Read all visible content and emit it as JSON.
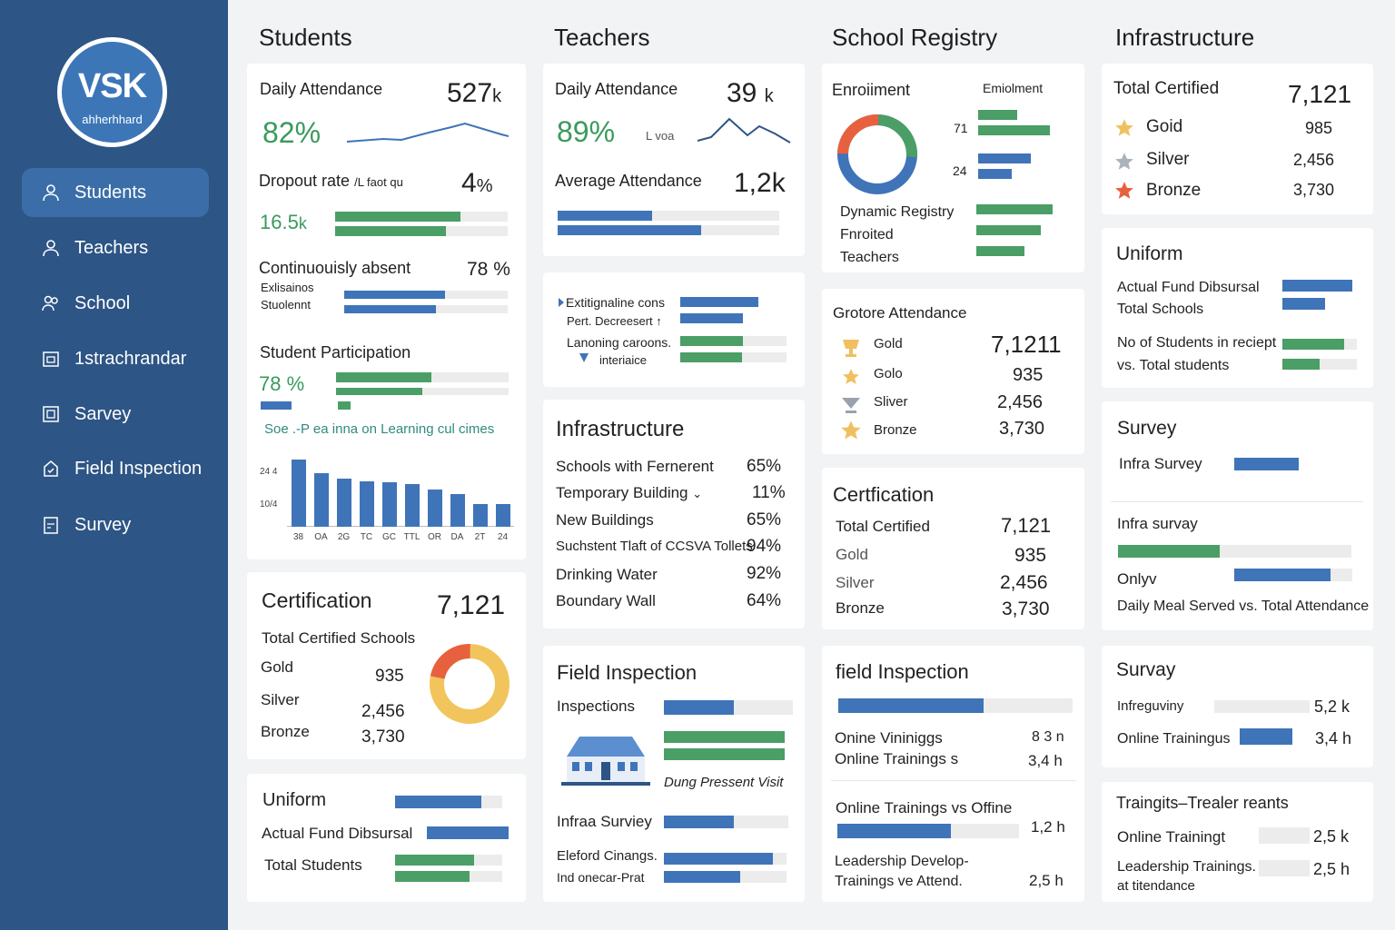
{
  "sidebar": {
    "logo_main": "VSK",
    "logo_sub": "ahherhhard",
    "items": [
      {
        "label": "Students",
        "icon": "user-icon"
      },
      {
        "label": "Teachers",
        "icon": "user-icon"
      },
      {
        "label": "School",
        "icon": "users-icon"
      },
      {
        "label": "1strachrandar",
        "icon": "calendar-icon"
      },
      {
        "label": "Sarvey",
        "icon": "clipboard-icon"
      },
      {
        "label": "Field Inspection",
        "icon": "inspection-icon"
      },
      {
        "label": "Survey",
        "icon": "document-icon"
      }
    ]
  },
  "headers": {
    "students": "Students",
    "teachers": "Teachers",
    "registry": "School Registry",
    "infrastructure": "Infrastructure"
  },
  "students": {
    "daily": {
      "title": "Daily Attendance",
      "value": "527",
      "unit": "k",
      "pct": "82%"
    },
    "dropout": {
      "title": "Dropout rate",
      "sub": "/L faot qu",
      "pct": "4",
      "unit": "%",
      "count": "16.5",
      "count_unit": "k"
    },
    "absent": {
      "title": "Continuouisly absent",
      "pct": "78",
      "unit": "%",
      "line1": "Exlisainos",
      "line2": "Stuolennt"
    },
    "participation": {
      "title": "Student Participation",
      "pct": "78",
      "unit": "%",
      "link": "Soe .-P ea inna on Learning cul cimes"
    },
    "chart": {
      "y1": "24 4",
      "y2": "10/4",
      "x": [
        "38",
        "OA",
        "2G",
        "TC",
        "GC",
        "TTL",
        "OR",
        "DA",
        "2T",
        "24"
      ],
      "values": [
        100,
        80,
        72,
        68,
        66,
        64,
        56,
        48,
        34,
        34
      ]
    },
    "certification": {
      "title": "Certification",
      "value": "7,121",
      "sub": "Total Certified Schools",
      "rows": [
        {
          "label": "Gold",
          "value": "935"
        },
        {
          "label": "Silver",
          "value": "2,456"
        },
        {
          "label": "Bronze",
          "value": "3,730"
        }
      ]
    },
    "uniform": {
      "title": "Uniform",
      "row1": "Actual Fund Dibsursal",
      "row2": "Total Students"
    }
  },
  "teachers": {
    "daily": {
      "title": "Daily Attendance",
      "value": "39",
      "unit": "k",
      "pct": "89%",
      "sub": "L voa"
    },
    "average": {
      "title": "Average Attendance",
      "value": "1,2k"
    },
    "misc": {
      "row1": "Extitignaline cons",
      "row2": "Pert. Decreesert ↑",
      "row3": "Lanoning caroons.",
      "row4": "interiaice"
    },
    "infrastructure": {
      "title": "Infrastructure",
      "rows": [
        {
          "label": "Schools with Fernerent",
          "value": "65%"
        },
        {
          "label": "Temporary Building",
          "value": "11%"
        },
        {
          "label": "New Buildings",
          "value": "65%"
        },
        {
          "label": "Suchstent Tlaft of CCSVA Tollets",
          "value": "94%"
        },
        {
          "label": "Drinking Water",
          "value": "92%"
        },
        {
          "label": "Boundary Wall",
          "value": "64%"
        }
      ]
    },
    "field": {
      "title": "Field Inspection",
      "inspections": "Inspections",
      "visit": "Dung Pressent Visit",
      "infra": "Infraa Surviey",
      "eleford1": "Eleford Cinangs.",
      "eleford2": "Ind onecar-Prat"
    }
  },
  "registry": {
    "enrollment": {
      "title": "Enroiiment",
      "sub": "Emiolment",
      "n1": "71",
      "n2": "24",
      "l1": "Dynamic Registry",
      "l2": "Fnroited",
      "l3": "Teachers"
    },
    "attendance": {
      "title": "Grotore Attendance",
      "rows": [
        {
          "label": "Gold",
          "value": "7,1211"
        },
        {
          "label": "Golo",
          "value": "935"
        },
        {
          "label": "Sliver",
          "value": "2,456"
        },
        {
          "label": "Bronze",
          "value": "3,730"
        }
      ]
    },
    "certification": {
      "title": "Certfication",
      "rows": [
        {
          "label": "Total Certified",
          "value": "7,121"
        },
        {
          "label": "Gold",
          "value": "935"
        },
        {
          "label": "Silver",
          "value": "2,456"
        },
        {
          "label": "Bronze",
          "value": "3,730"
        }
      ]
    },
    "field": {
      "title": "field Inspection",
      "r1": "Onine Vininiggs",
      "r1v": "8 3 n",
      "r2": "Online Trainings s",
      "r2v": "3,4 h",
      "r3": "Online Trainings vs Offine",
      "r3v": "1,2 h",
      "r4a": "Leadership Develop-",
      "r4b": "Trainings ve Attend.",
      "r4v": "2,5 h"
    }
  },
  "infra": {
    "certified": {
      "title": "Total Certified",
      "value": "7,121",
      "rows": [
        {
          "label": "Goid",
          "value": "985"
        },
        {
          "label": "Silver",
          "value": "2,456"
        },
        {
          "label": "Bronze",
          "value": "3,730"
        }
      ]
    },
    "uniform": {
      "title": "Uniform",
      "r1": "Actual Fund Dibsursal",
      "r2": "Total Schools",
      "r3": "No of Students in reciept",
      "r4": "vs. Total students"
    },
    "survey1": {
      "title": "Survey",
      "r1": "Infra Survey",
      "r2": "Infra survay",
      "r3": "Onlyv",
      "r4": "Daily Meal Served vs. Total Attendance"
    },
    "survey2": {
      "title": "Survay",
      "r1": "Infreguviny",
      "r1v": "5,2 k",
      "r2": "Online Trainingus",
      "r2v": "3,4 h"
    },
    "trainings": {
      "title": "Traingits–Trealer reants",
      "r1": "Online Trainingt",
      "r1v": "2,5 k",
      "r2a": "Leadership Trainings.",
      "r2b": "at titendance",
      "r2v": "2,5 h"
    }
  },
  "colors": {
    "sidebar": "#2d5585",
    "blue": "#3f74b8",
    "green": "#4a9e66",
    "gold": "#f0c060",
    "orange": "#e8613f"
  }
}
